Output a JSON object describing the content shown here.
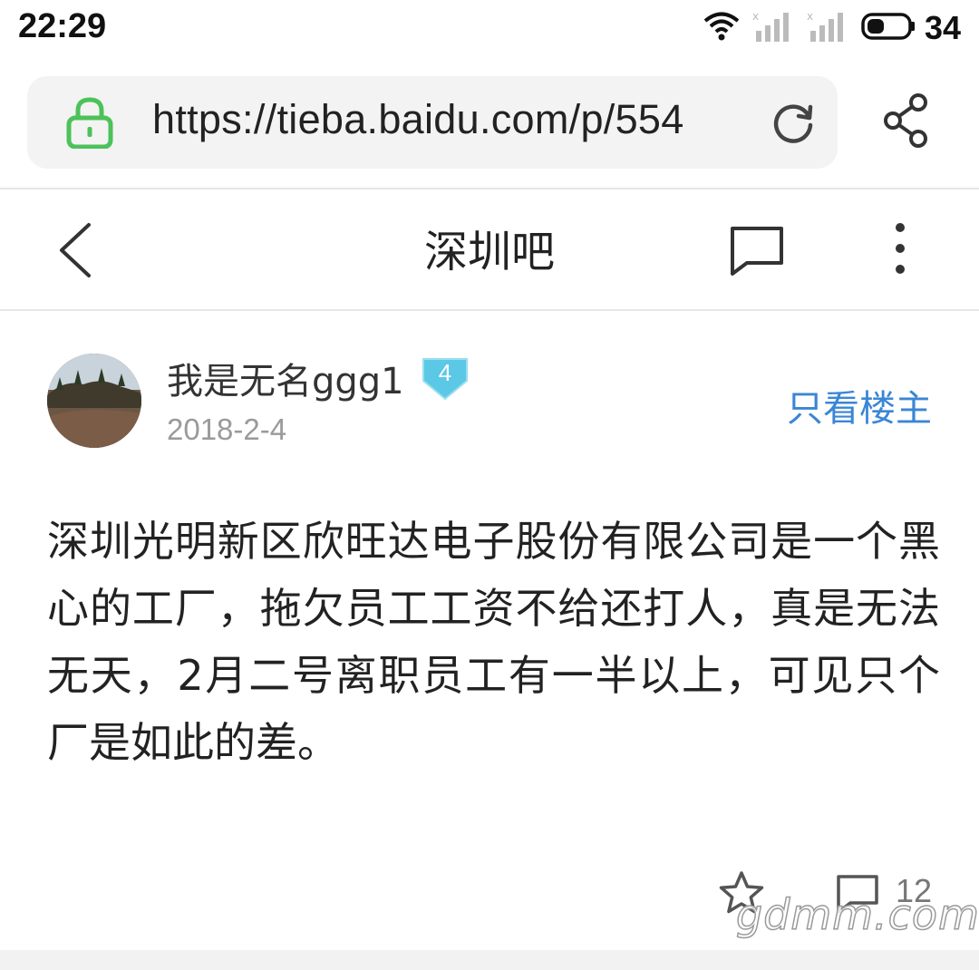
{
  "status_bar": {
    "time": "22:29",
    "battery": "34",
    "icons": [
      "wifi-icon",
      "signal-icon",
      "signal-icon",
      "battery-icon"
    ]
  },
  "browser": {
    "url": "https://tieba.baidu.com/p/554",
    "icons": [
      "lock-icon",
      "reload-icon",
      "share-icon"
    ],
    "lock_color": "#4cc25a"
  },
  "nav": {
    "title": "深圳吧",
    "icons": [
      "back-icon",
      "comment-icon",
      "more-icon"
    ]
  },
  "post": {
    "username": "我是无名ggg1",
    "level": "4",
    "date": "2018-2-4",
    "only_op_label": "只看楼主",
    "content": "深圳光明新区欣旺达电子股份有限公司是一个黑心的工厂，拖欠员工工资不给还打人，真是无法无天，2月二号离职员工有一半以上，可见只个厂是如此的差。",
    "reply_count": "12",
    "icons": [
      "star-icon",
      "reply-icon"
    ]
  },
  "watermark": "gdmm.com",
  "colors": {
    "accent": "#3a86d6",
    "badge": "#5bc8e6",
    "meta_text": "#9a9a9a"
  }
}
